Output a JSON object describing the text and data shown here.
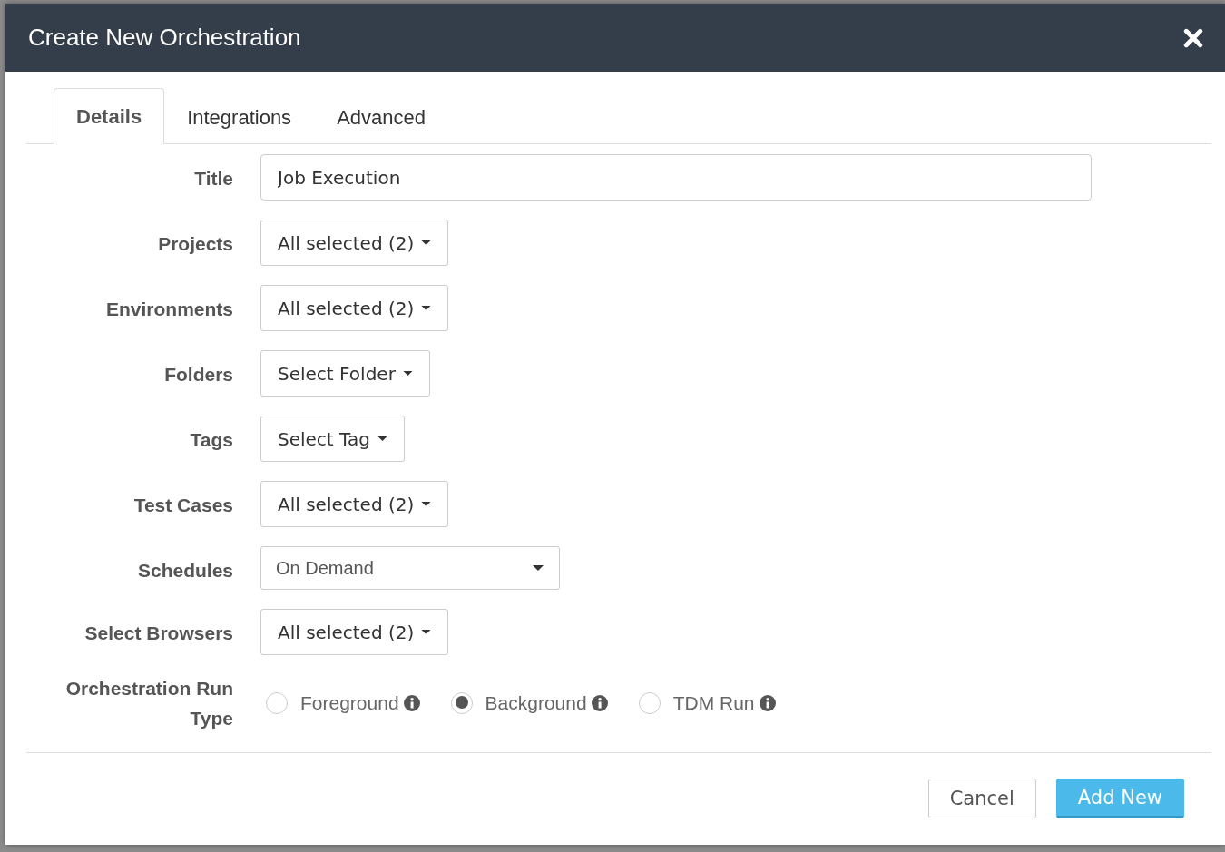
{
  "window": {
    "title": "Create New Orchestration"
  },
  "tabs": [
    {
      "label": "Details",
      "selected": true
    },
    {
      "label": "Integrations",
      "selected": false
    },
    {
      "label": "Advanced",
      "selected": false
    }
  ],
  "fields": [
    {
      "kind": "text",
      "label": "Title",
      "value": "Job Execution"
    },
    {
      "kind": "dropdown",
      "label": "Projects",
      "value": "All selected (2)"
    },
    {
      "kind": "dropdown",
      "label": "Environments",
      "value": "All selected (2)"
    },
    {
      "kind": "dropdown",
      "label": "Folders",
      "value": "Select Folder"
    },
    {
      "kind": "dropdown",
      "label": "Tags",
      "value": "Select Tag"
    },
    {
      "kind": "dropdown",
      "label": "Test Cases",
      "value": "All selected (2)"
    },
    {
      "kind": "select",
      "label": "Schedules",
      "value": "On Demand"
    },
    {
      "kind": "dropdown",
      "label": "Select Browsers",
      "value": "All selected (2)"
    },
    {
      "kind": "radio",
      "label": "Orchestration Run Type",
      "options": [
        {
          "label": "Foreground",
          "selected": false
        },
        {
          "label": "Background",
          "selected": true
        },
        {
          "label": "TDM Run",
          "selected": false
        }
      ]
    }
  ],
  "buttons": [
    {
      "kind": "secondary",
      "label": "Cancel"
    },
    {
      "kind": "primary",
      "label": "Add New"
    }
  ]
}
